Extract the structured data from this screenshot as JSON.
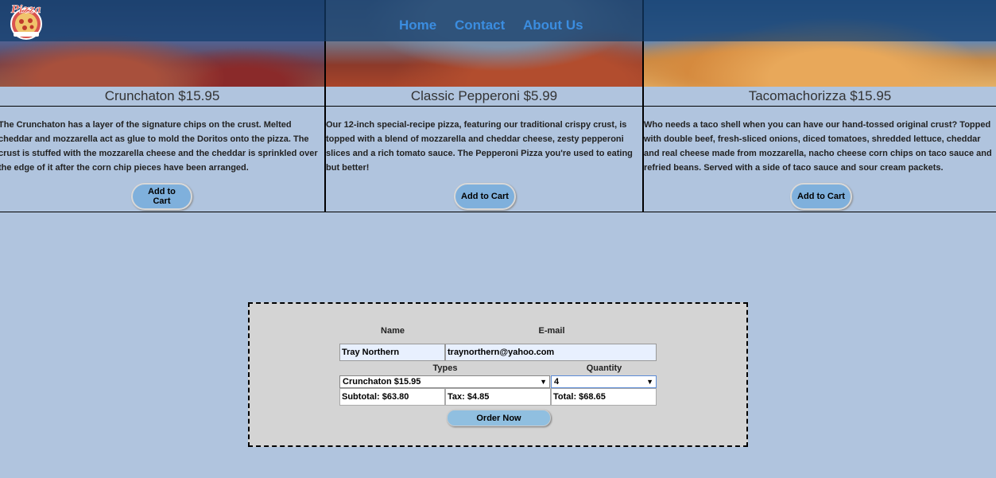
{
  "nav": {
    "logo_text": "Pizza",
    "links": [
      "Home",
      "Contact",
      "About Us"
    ]
  },
  "products": [
    {
      "name": "Crunchaton $15.95",
      "description": "The Crunchaton has a layer of the signature chips on the crust. Melted cheddar and mozzarella act as glue to mold the Doritos onto the pizza. The crust is stuffed with the mozzarella cheese and the cheddar is sprinkled over the edge of it after the corn chip pieces have been arranged.",
      "button": "Add to Cart"
    },
    {
      "name": "Classic Pepperoni $5.99",
      "description": "Our 12-inch special-recipe pizza, featuring our traditional crispy crust, is topped with a blend of mozzarella and cheddar cheese, zesty pepperoni slices and a rich tomato sauce. The Pepperoni Pizza you're used to eating but better!",
      "button": "Add to Cart"
    },
    {
      "name": "Tacomachorizza $15.95",
      "description": "Who needs a taco shell when you can have our hand-tossed original crust? Topped with double beef, fresh-sliced onions, diced tomatoes, shredded lettuce, cheddar and real cheese made from mozzarella, nacho cheese corn chips on taco sauce and refried beans. Served with a side of taco sauce and sour cream packets.",
      "button": "Add to Cart"
    }
  ],
  "order": {
    "name_label": "Name",
    "email_label": "E-mail",
    "name_value": "Tray Northern",
    "email_value": "traynorthern@yahoo.com",
    "types_label": "Types",
    "quantity_label": "Quantity",
    "type_selected": "Crunchaton $15.95",
    "quantity_selected": "4",
    "subtotal": "Subtotal: $63.80",
    "tax": "Tax: $4.85",
    "total": "Total: $68.65",
    "button": "Order Now"
  },
  "colors": {
    "background": "#b0c4de",
    "nav_link": "#3b8de0",
    "button": "#7fb0dc",
    "form_bg": "#d4d4d4"
  }
}
